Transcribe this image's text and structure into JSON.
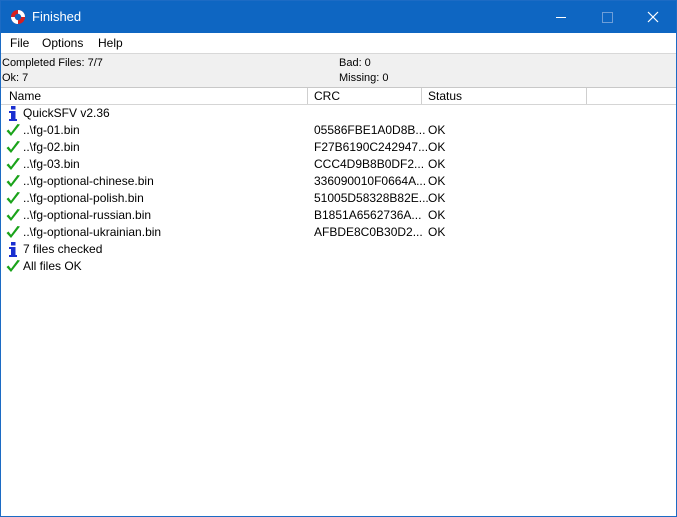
{
  "window": {
    "title": "Finished"
  },
  "icons": {
    "app": "lifebuoy-icon",
    "minimize": "minimize-icon",
    "maximize": "maximize-icon",
    "close": "close-icon",
    "ok": "green-check-icon",
    "info": "info-icon"
  },
  "colors": {
    "titlebar": "#0e66c2",
    "check": "#1aa31a",
    "info": "#1a2fd0"
  },
  "menu": [
    "File",
    "Options",
    "Help"
  ],
  "status": {
    "completed": "Completed Files: 7/7",
    "ok": "Ok: 7",
    "bad": "Bad: 0",
    "missing": "Missing: 0"
  },
  "columns": {
    "name": "Name",
    "crc": "CRC",
    "status": "Status"
  },
  "rows": [
    {
      "icon": "info",
      "name": "QuickSFV v2.36",
      "crc": "",
      "status": ""
    },
    {
      "icon": "ok",
      "name": "..\\fg-01.bin",
      "crc": "05586FBE1A0D8B...",
      "status": "OK"
    },
    {
      "icon": "ok",
      "name": "..\\fg-02.bin",
      "crc": "F27B6190C242947...",
      "status": "OK"
    },
    {
      "icon": "ok",
      "name": "..\\fg-03.bin",
      "crc": "CCC4D9B8B0DF2...",
      "status": "OK"
    },
    {
      "icon": "ok",
      "name": "..\\fg-optional-chinese.bin",
      "crc": "336090010F0664A...",
      "status": "OK"
    },
    {
      "icon": "ok",
      "name": "..\\fg-optional-polish.bin",
      "crc": "51005D58328B82E...",
      "status": "OK"
    },
    {
      "icon": "ok",
      "name": "..\\fg-optional-russian.bin",
      "crc": "B1851A6562736A...",
      "status": "OK"
    },
    {
      "icon": "ok",
      "name": "..\\fg-optional-ukrainian.bin",
      "crc": "AFBDE8C0B30D2...",
      "status": "OK"
    },
    {
      "icon": "info",
      "name": "7 files checked",
      "crc": "",
      "status": ""
    },
    {
      "icon": "ok",
      "name": "All files OK",
      "crc": "",
      "status": ""
    }
  ]
}
